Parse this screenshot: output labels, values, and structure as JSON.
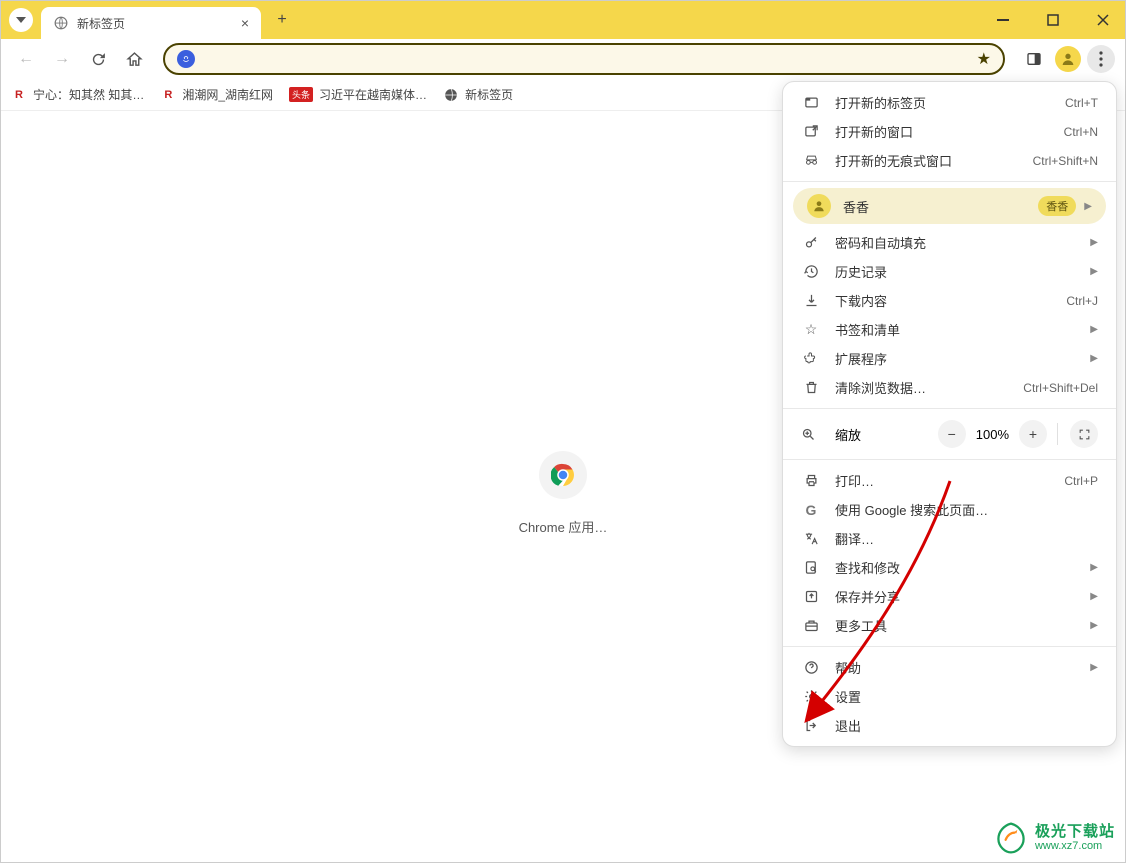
{
  "tab": {
    "title": "新标签页"
  },
  "bookmarks": [
    {
      "label": "宁心：知其然 知其…"
    },
    {
      "label": "湘潮网_湖南红网"
    },
    {
      "label": "习近平在越南媒体…",
      "badge": "头条"
    },
    {
      "label": "新标签页"
    }
  ],
  "content": {
    "app_label": "Chrome 应用…"
  },
  "menu": {
    "new_tab": {
      "label": "打开新的标签页",
      "shortcut": "Ctrl+T"
    },
    "new_window": {
      "label": "打开新的窗口",
      "shortcut": "Ctrl+N"
    },
    "incognito": {
      "label": "打开新的无痕式窗口",
      "shortcut": "Ctrl+Shift+N"
    },
    "profile": {
      "name": "香香",
      "badge": "香香"
    },
    "passwords": {
      "label": "密码和自动填充"
    },
    "history": {
      "label": "历史记录"
    },
    "downloads": {
      "label": "下载内容",
      "shortcut": "Ctrl+J"
    },
    "bookmarks": {
      "label": "书签和清单"
    },
    "extensions": {
      "label": "扩展程序"
    },
    "clear_data": {
      "label": "清除浏览数据…",
      "shortcut": "Ctrl+Shift+Del"
    },
    "zoom": {
      "label": "缩放",
      "value": "100%"
    },
    "print": {
      "label": "打印…",
      "shortcut": "Ctrl+P"
    },
    "search": {
      "label": "使用 Google 搜索此页面…"
    },
    "translate": {
      "label": "翻译…"
    },
    "find": {
      "label": "查找和修改"
    },
    "save_share": {
      "label": "保存并分享"
    },
    "more_tools": {
      "label": "更多工具"
    },
    "help": {
      "label": "帮助"
    },
    "settings": {
      "label": "设置"
    },
    "exit": {
      "label": "退出"
    }
  },
  "watermark": {
    "cn": "极光下载站",
    "url": "www.xz7.com"
  }
}
